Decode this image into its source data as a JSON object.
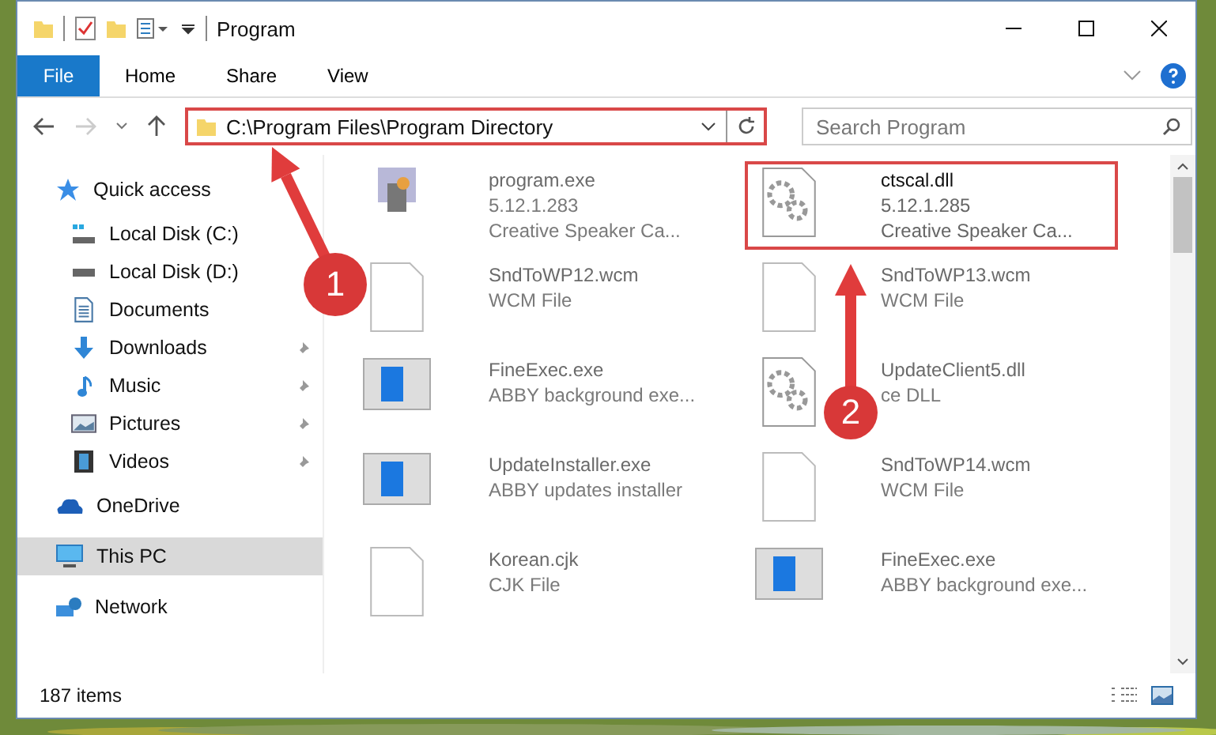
{
  "window": {
    "title": "Program"
  },
  "ribbon_tabs": [
    {
      "label": "File",
      "selected": true
    },
    {
      "label": "Home",
      "selected": false
    },
    {
      "label": "Share",
      "selected": false
    },
    {
      "label": "View",
      "selected": false
    }
  ],
  "address": {
    "path": "C:\\Program Files\\Program Directory",
    "highlighted": true
  },
  "search": {
    "placeholder": "Search Program"
  },
  "sidebar": {
    "items": [
      {
        "label": "Quick access",
        "selected": false,
        "children": [
          {
            "label": "Local Disk (C:)"
          },
          {
            "label": "Local Disk (D:)"
          },
          {
            "label": "Documents"
          },
          {
            "label": "Downloads",
            "pinned": true
          },
          {
            "label": "Music",
            "pinned": true
          },
          {
            "label": "Pictures",
            "pinned": true
          },
          {
            "label": "Videos",
            "pinned": true
          }
        ]
      },
      {
        "label": "OneDrive",
        "selected": false
      },
      {
        "label": "This PC",
        "selected": true
      },
      {
        "label": "Network",
        "selected": false
      }
    ]
  },
  "files": [
    {
      "name": "program.exe",
      "lines": [
        "5.12.1.283",
        "Creative Speaker Ca..."
      ],
      "dimmed": true,
      "highlighted": false
    },
    {
      "name": "ctscal.dll",
      "lines": [
        "5.12.1.285",
        "Creative Speaker Ca..."
      ],
      "dimmed": false,
      "highlighted": true
    },
    {
      "name": "SndToWP12.wcm",
      "lines": [
        "WCM File"
      ],
      "dimmed": true,
      "highlighted": false
    },
    {
      "name": "SndToWP13.wcm",
      "lines": [
        "WCM File"
      ],
      "dimmed": true,
      "highlighted": false
    },
    {
      "name": "FineExec.exe",
      "lines": [
        "ABBY background exe..."
      ],
      "dimmed": true,
      "highlighted": false
    },
    {
      "name": "UpdateClient5.dll",
      "lines": [
        "ce DLL"
      ],
      "dimmed": true,
      "highlighted": false
    },
    {
      "name": "UpdateInstaller.exe",
      "lines": [
        "ABBY updates installer"
      ],
      "dimmed": true,
      "highlighted": false
    },
    {
      "name": "SndToWP14.wcm",
      "lines": [
        "WCM File"
      ],
      "dimmed": true,
      "highlighted": false
    },
    {
      "name": "Korean.cjk",
      "lines": [
        "CJK File"
      ],
      "dimmed": true,
      "highlighted": false
    },
    {
      "name": "FineExec.exe",
      "lines": [
        "ABBY background exe..."
      ],
      "dimmed": true,
      "highlighted": false
    }
  ],
  "status_bar": {
    "count": "187 items"
  },
  "annotations": [
    {
      "label": "1"
    },
    {
      "label": "2"
    }
  ]
}
